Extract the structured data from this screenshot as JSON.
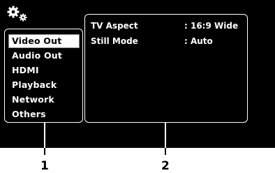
{
  "menu": {
    "items": [
      {
        "label": "Video Out",
        "selected": true
      },
      {
        "label": "Audio Out",
        "selected": false
      },
      {
        "label": "HDMI",
        "selected": false
      },
      {
        "label": "Playback",
        "selected": false
      },
      {
        "label": "Network",
        "selected": false
      },
      {
        "label": "Others",
        "selected": false
      }
    ]
  },
  "settings": {
    "rows": [
      {
        "label": "TV Aspect",
        "value": ": 16:9 Wide"
      },
      {
        "label": "Still Mode",
        "value": ": Auto"
      }
    ]
  },
  "callouts": [
    "1",
    "2"
  ],
  "colors": {
    "screen_bg": "#000000",
    "highlight": "#ffffff",
    "text": "#ffffff"
  },
  "icons": {
    "setup": "gears-icon"
  }
}
